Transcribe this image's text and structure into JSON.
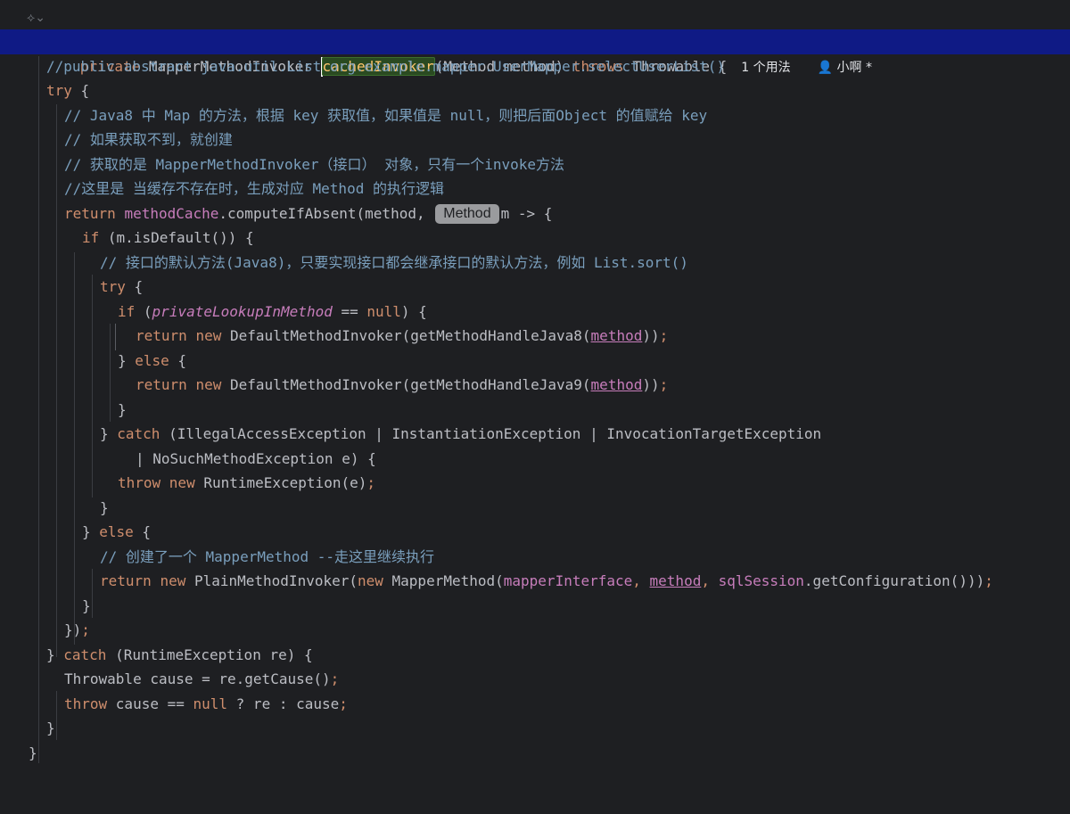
{
  "gutter": {
    "icon": "ai-assistant-icon",
    "glyph": "⟡⌄"
  },
  "inlay": {
    "usages": "1 个用法",
    "author": "小啊 *",
    "param_hint": "Method"
  },
  "code": {
    "l01": {
      "a": "private ",
      "b": "MapperMethodInvoker ",
      "c": "cachedInvoker",
      "d": "(Method method) ",
      "e": "throws ",
      "f": "Throwable {"
    },
    "l02": "//public abstract java.util.List org.example.mapper.UserMapper.selectUserList()",
    "l03": {
      "a": "try",
      "b": " {"
    },
    "l04": "// Java8 中 Map 的方法，根据 key 获取值，如果值是 null，则把后面Object 的值赋给 key",
    "l05": "// 如果获取不到，就创建",
    "l06": "// 获取的是 MapperMethodInvoker（接口） 对象，只有一个invoke方法",
    "l07": "//这里是 当缓存不存在时，生成对应 Method 的执行逻辑",
    "l08": {
      "a": "return ",
      "b": "methodCache",
      "c": ".computeIfAbsent(method, ",
      "d": "m -> {"
    },
    "l09": {
      "a": "if ",
      "b": "(m.isDefault()) {"
    },
    "l10": "// 接口的默认方法(Java8)，只要实现接口都会继承接口的默认方法，例如 List.sort()",
    "l11": {
      "a": "try",
      "b": " {"
    },
    "l12": {
      "a": "if ",
      "b": "(",
      "c": "privateLookupInMethod",
      "d": " == ",
      "e": "null",
      "f": ") {"
    },
    "l13": {
      "a": "return ",
      "b": "new ",
      "c": "DefaultMethodInvoker(getMethodHandleJava8(",
      "d": "method",
      "e": "))",
      "f": ";"
    },
    "l14": {
      "a": "} ",
      "b": "else",
      "c": " {"
    },
    "l15": {
      "a": "return ",
      "b": "new ",
      "c": "DefaultMethodInvoker(getMethodHandleJava9(",
      "d": "method",
      "e": "))",
      "f": ";"
    },
    "l16": "}",
    "l17": {
      "a": "} ",
      "b": "catch ",
      "c": "(IllegalAccessException | InstantiationException | InvocationTargetException"
    },
    "l18": "| NoSuchMethodException e) {",
    "l19": {
      "a": "throw ",
      "b": "new ",
      "c": "RuntimeException(e)",
      "d": ";"
    },
    "l20": "}",
    "l21": {
      "a": "} ",
      "b": "else",
      "c": " {"
    },
    "l22": "// 创建了一个 MapperMethod --走这里继续执行",
    "l23": {
      "a": "return ",
      "b": "new ",
      "c": "PlainMethodInvoker(",
      "d": "new ",
      "e": "MapperMethod(",
      "f": "mapperInterface",
      "g": ", ",
      "h": "method",
      "i": ", ",
      "j": "sqlSession",
      "k": ".getConfiguration()))",
      "l": ";"
    },
    "l24": "}",
    "l25": {
      "a": "})",
      "b": ";"
    },
    "l26": {
      "a": "} ",
      "b": "catch ",
      "c": "(RuntimeException re) {"
    },
    "l27": {
      "a": "Throwable cause = re.getCause()",
      "b": ";"
    },
    "l28": {
      "a": "throw ",
      "b": "cause == ",
      "c": "null",
      "d": " ? re : cause",
      "e": ";"
    },
    "l29": "}",
    "l30": "}"
  }
}
